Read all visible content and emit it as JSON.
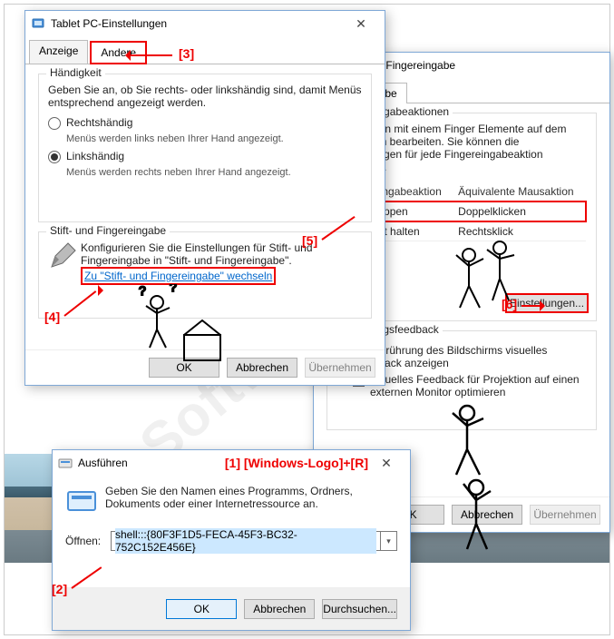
{
  "watermark": "SoftwareOK.de",
  "annotations": {
    "a1": "[1] [Windows-Logo]+[R]",
    "a2": "[2]",
    "a3": "[3]",
    "a4": "[4]",
    "a5": "[5]",
    "a6": "[6]"
  },
  "win1": {
    "title": "Tablet PC-Einstellungen",
    "tabs": {
      "display": "Anzeige",
      "other": "Andere"
    },
    "hand": {
      "legend": "Händigkeit",
      "intro": "Geben Sie an, ob Sie rechts- oder linkshändig sind, damit Menüs entsprechend angezeigt werden.",
      "right": "Rechtshändig",
      "right_desc": "Menüs werden links neben Ihrer Hand angezeigt.",
      "left": "Linkshändig",
      "left_desc": "Menüs werden rechts neben Ihrer Hand angezeigt."
    },
    "pen": {
      "legend": "Stift- und Fingereingabe",
      "desc": "Konfigurieren Sie die Einstellungen für Stift- und Fingereingabe in \"Stift- und Fingereingabe\".",
      "link": "Zu \"Stift- und Fingereingabe\" wechseln"
    },
    "buttons": {
      "ok": "OK",
      "cancel": "Abbrechen",
      "apply": "Übernehmen"
    }
  },
  "win2": {
    "title": "Stift- und Fingereingabe",
    "tab": "Fingereingabe",
    "actions": {
      "legend": "Fingereingabeaktionen",
      "intro": "Sie können mit einem Finger Elemente auf dem Bildschirm bearbeiten. Sie können die Einstellungen für jede Fingereingabeaktion anpassen.",
      "col1": "Fingereingabeaktion",
      "col2": "Äquivalente Mausaktion",
      "rows": [
        {
          "a": "Doppeltippen",
          "b": "Doppelklicken"
        },
        {
          "a": "Gedrückt halten",
          "b": "Rechtsklick"
        }
      ],
      "settings_btn": "Einstellungen..."
    },
    "feedback": {
      "legend": "Berührungsfeedback",
      "cb1": "Bei Berührung des Bildschirms visuelles Feedback anzeigen",
      "cb2": "Visuelles Feedback für Projektion auf einen externen Monitor optimieren"
    },
    "buttons": {
      "ok": "OK",
      "cancel": "Abbrechen",
      "apply": "Übernehmen"
    }
  },
  "run": {
    "title": "Ausführen",
    "desc": "Geben Sie den Namen eines Programms, Ordners, Dokuments oder einer Internetressource an.",
    "label": "Öffnen:",
    "value": "shell:::{80F3F1D5-FECA-45F3-BC32-752C152E456E}",
    "ok": "OK",
    "cancel": "Abbrechen",
    "browse": "Durchsuchen..."
  }
}
